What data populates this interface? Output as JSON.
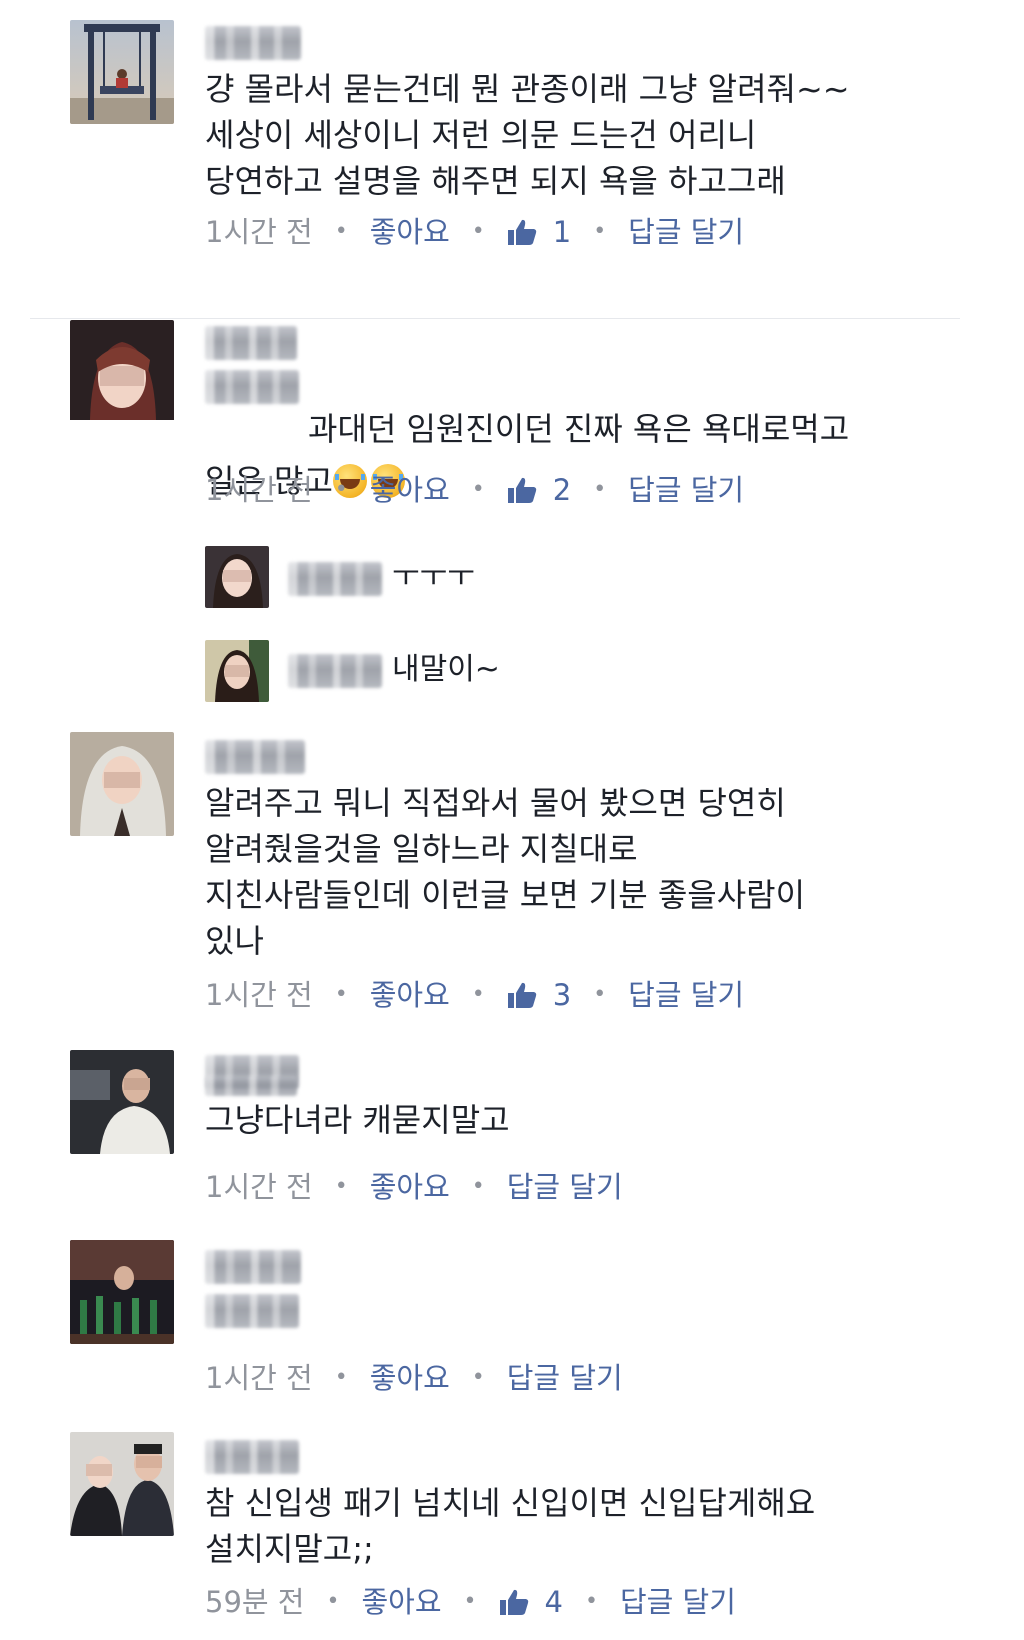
{
  "comments": [
    {
      "text": "걍 몰라서 묻는건데 뭔 관종이래 그냥 알려줘~~\n세상이 세상이니 저런 의문 드는건 어리니\n당연하고 설명을 해주면 되지 욕을 하고그래",
      "time": "1시간 전",
      "like_label": "좋아요",
      "likes": "1",
      "reply_label": "답글 달기"
    },
    {
      "text_prefix": "과대던 임원진이던 진짜 욕은 욕대로먹고",
      "text_line2": "일은 많고",
      "emoji": [
        "laughing-tears-emoji",
        "laughing-tears-emoji"
      ],
      "time": "1시간 전",
      "like_label": "좋아요",
      "likes": "2",
      "reply_label": "답글 달기",
      "replies": [
        {
          "text": "ㅜㅜㅜ"
        },
        {
          "text": "내말이~"
        }
      ]
    },
    {
      "text": "알려주고 뭐니 직접와서 물어 봤으면 당연히\n알려줬을것을 일하느라 지칠대로\n지친사람들인데 이런글 보면 기분 좋을사람이\n있나",
      "time": "1시간 전",
      "like_label": "좋아요",
      "likes": "3",
      "reply_label": "답글 달기"
    },
    {
      "text": "그냥다녀라 캐묻지말고",
      "time": "1시간 전",
      "like_label": "좋아요",
      "reply_label": "답글 달기"
    },
    {
      "text": "",
      "time": "1시간 전",
      "like_label": "좋아요",
      "reply_label": "답글 달기"
    },
    {
      "text": "참 신입생 패기 넘치네 신입이면 신입답게해요\n설치지말고;;",
      "time": "59분 전",
      "like_label": "좋아요",
      "likes": "4",
      "reply_label": "답글 달기"
    }
  ],
  "colors": {
    "text": "#1d2129",
    "meta": "#90949c",
    "link": "#4b67a1",
    "separator": "#e6e8ec"
  }
}
